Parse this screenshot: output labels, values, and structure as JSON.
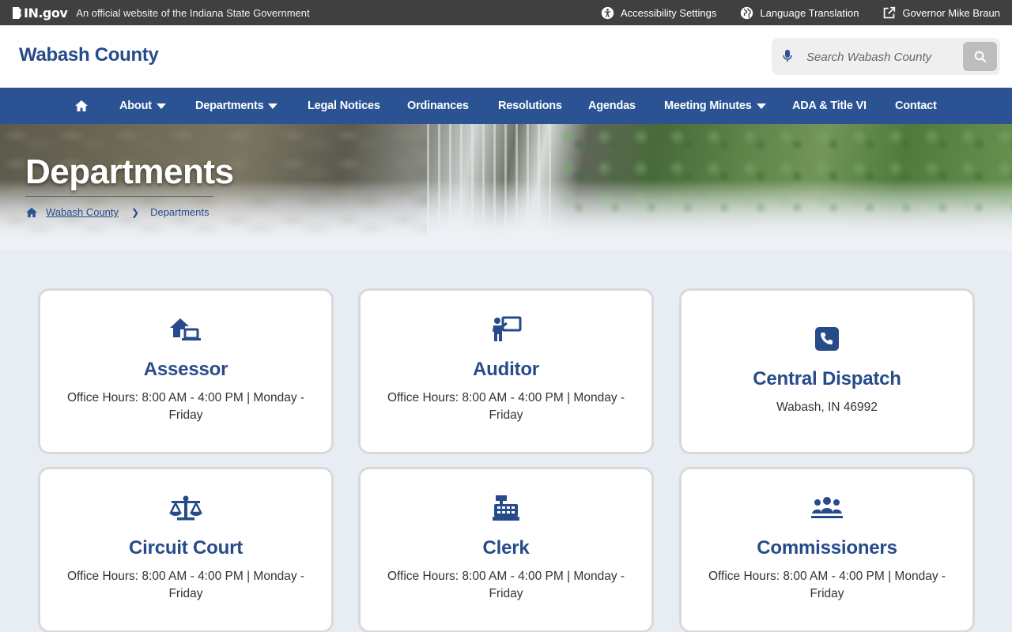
{
  "statebar": {
    "logo_text": "IN.gov",
    "tagline": "An official website of the Indiana State Government",
    "links": [
      {
        "label": "Accessibility Settings",
        "icon": "accessibility-icon"
      },
      {
        "label": "Language Translation",
        "icon": "globe-icon"
      },
      {
        "label": "Governor Mike Braun",
        "icon": "external-link-icon"
      }
    ]
  },
  "header": {
    "site_title": "Wabash County",
    "search_placeholder": "Search Wabash County"
  },
  "nav": {
    "items": [
      {
        "label": "About"
      },
      {
        "label": "Departments"
      },
      {
        "label": "Legal Notices"
      },
      {
        "label": "Ordinances"
      },
      {
        "label": "Resolutions"
      },
      {
        "label": "Agendas"
      },
      {
        "label": "Meeting Minutes"
      },
      {
        "label": "ADA & Title VI"
      },
      {
        "label": "Contact"
      }
    ]
  },
  "hero": {
    "title": "Departments",
    "breadcrumb": [
      "Wabash County",
      "Departments"
    ]
  },
  "cards": [
    {
      "title": "Assessor",
      "line1": "Office Hours: 8:00 AM - 4:00 PM | Monday -",
      "line2": "Friday",
      "icon": "house-laptop-icon"
    },
    {
      "title": "Auditor",
      "line1": "Office Hours: 8:00 AM - 4:00 PM | Monday -",
      "line2": "Friday",
      "icon": "presenter-board-icon"
    },
    {
      "title": "Central Dispatch",
      "line1": "Wabash, IN 46992",
      "line2": "",
      "icon": "phone-square-icon"
    },
    {
      "title": "Circuit Court",
      "line1": "Office Hours: 8:00 AM - 4:00 PM | Monday -",
      "line2": "Friday",
      "icon": "scales-icon"
    },
    {
      "title": "Clerk",
      "line1": "Office Hours: 8:00 AM - 4:00 PM | Monday -",
      "line2": "Friday",
      "icon": "cash-register-icon"
    },
    {
      "title": "Commissioners",
      "line1": "Office Hours: 8:00 AM - 4:00 PM | Monday -",
      "line2": "Friday",
      "icon": "people-group-icon"
    }
  ],
  "colors": {
    "brand_blue": "#2b5394",
    "title_blue": "#274b8a",
    "statebar": "#404040"
  }
}
